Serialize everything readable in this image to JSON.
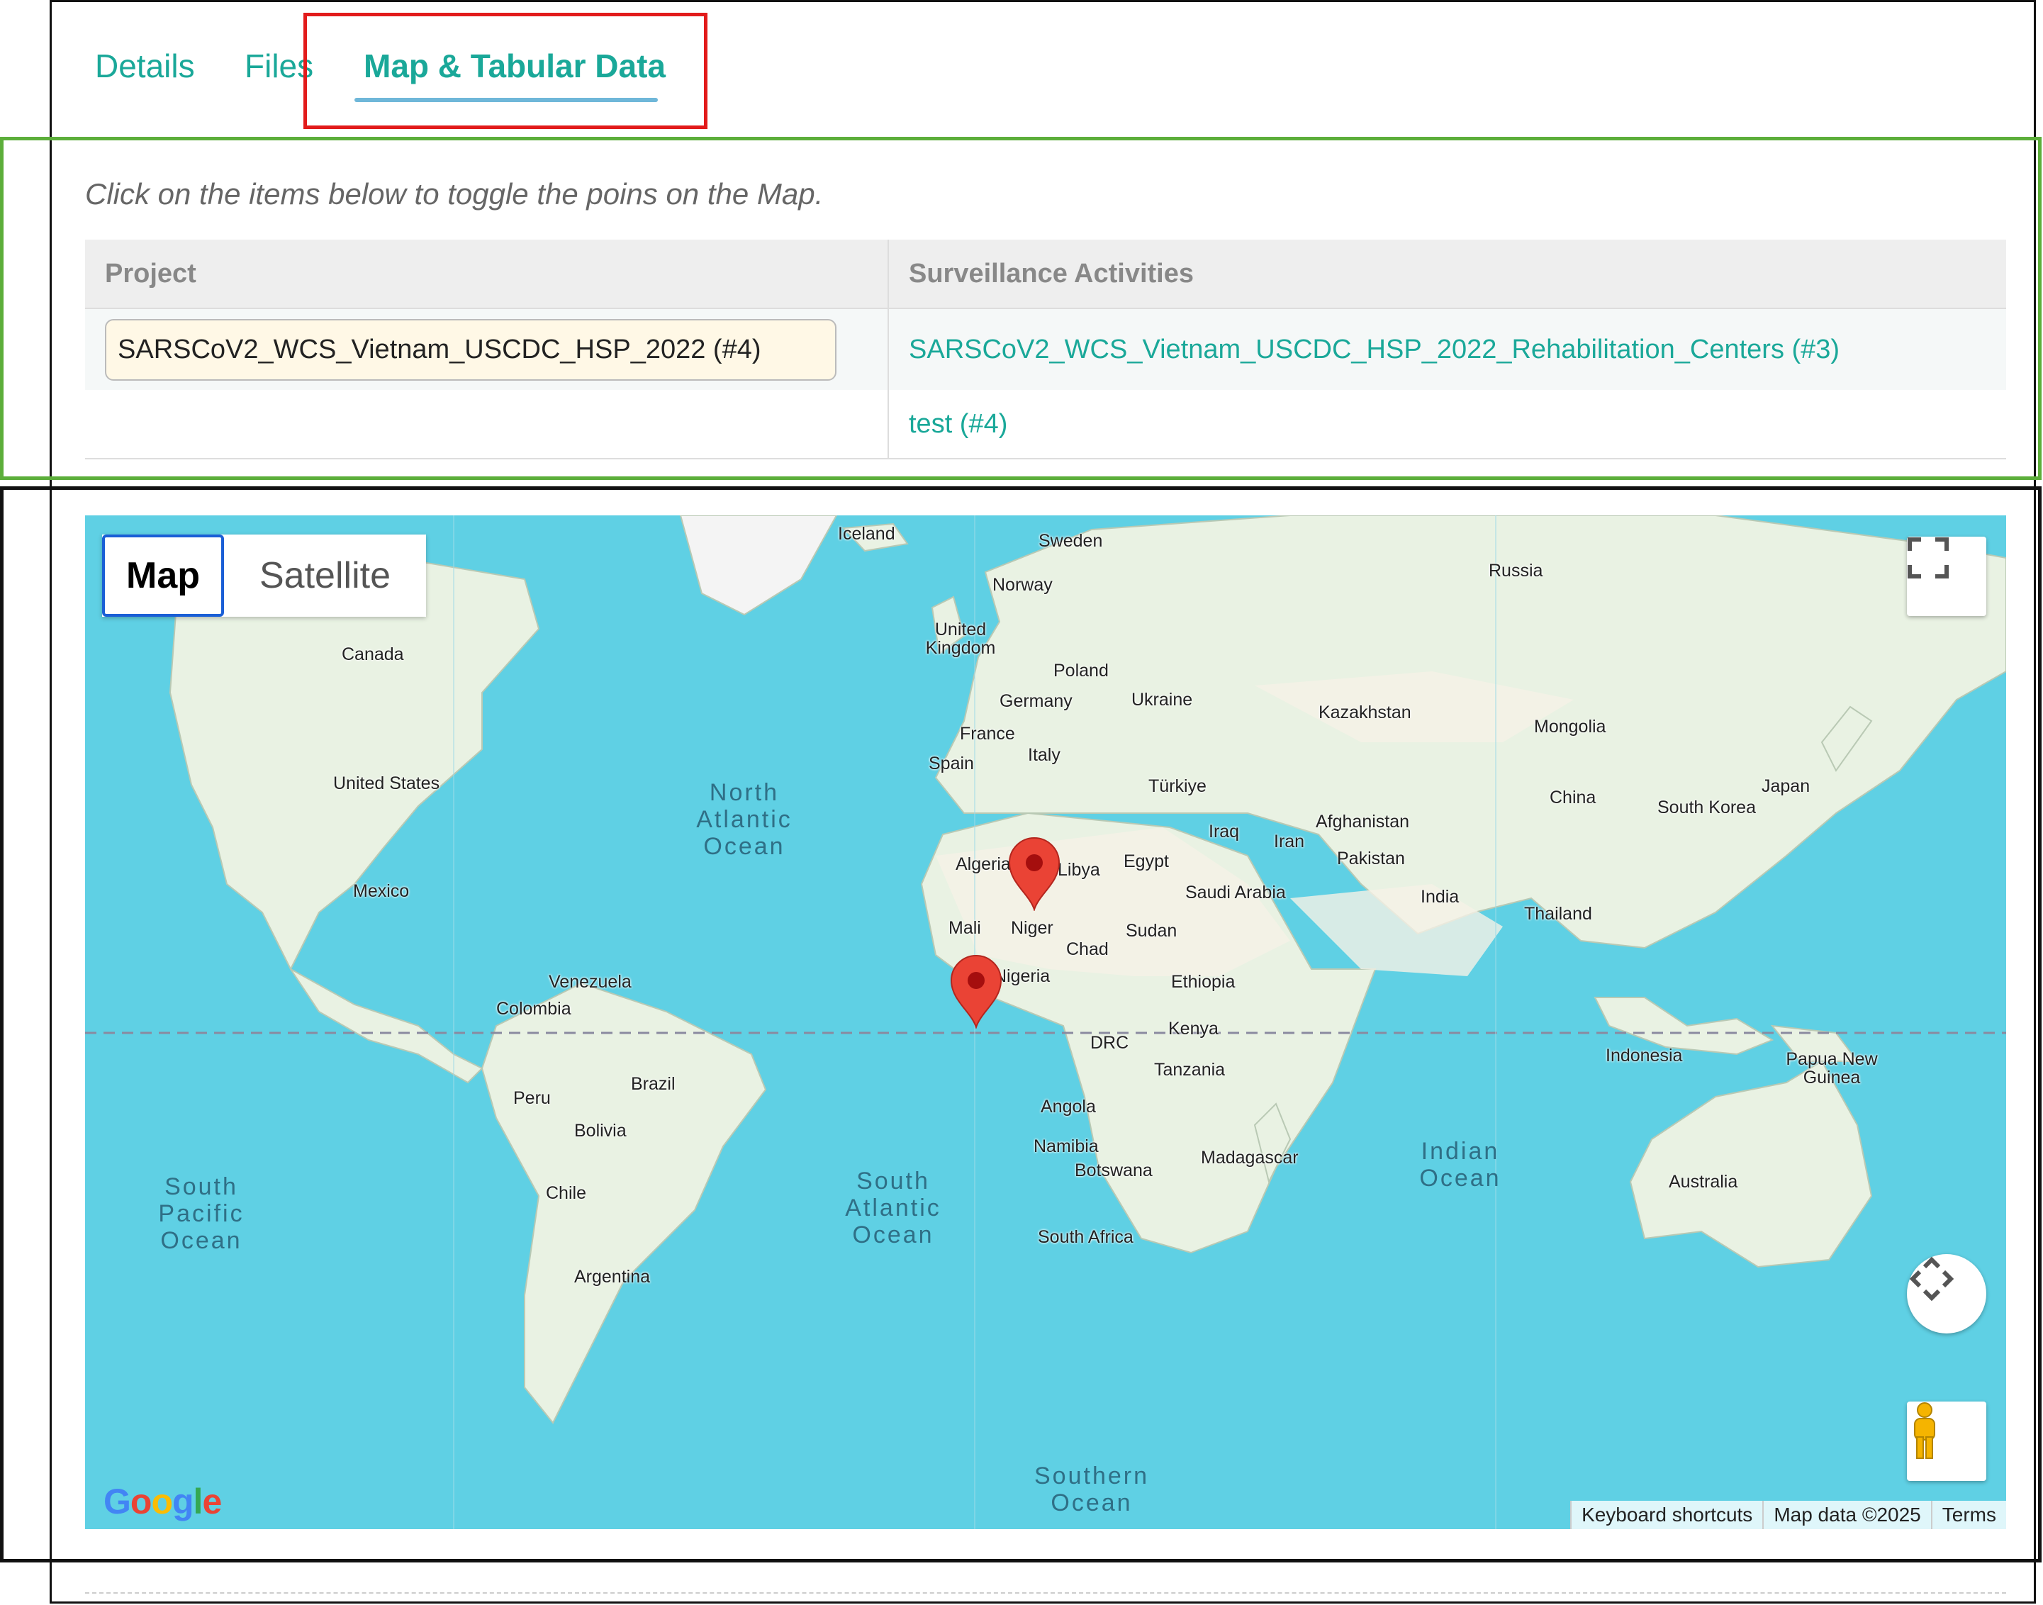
{
  "tabs": [
    {
      "label": "Details"
    },
    {
      "label": "Files"
    },
    {
      "label": "Map & Tabular Data"
    }
  ],
  "hint": "Click on the items below to toggle the poins on the Map.",
  "table": {
    "headers": [
      "Project",
      "Surveillance Activities"
    ],
    "project": "SARSCoV2_WCS_Vietnam_USCDC_HSP_2022 (#4)",
    "activities": [
      "SARSCoV2_WCS_Vietnam_USCDC_HSP_2022_Rehabilitation_Centers (#3)",
      "test (#4)"
    ]
  },
  "map": {
    "type_buttons": {
      "map": "Map",
      "satellite": "Satellite"
    },
    "countries": {
      "iceland": "Iceland",
      "sweden": "Sweden",
      "norway": "Norway",
      "russia": "Russia",
      "uk": "United Kingdom",
      "poland": "Poland",
      "germany": "Germany",
      "ukraine": "Ukraine",
      "france": "France",
      "italy": "Italy",
      "spain": "Spain",
      "kazakhstan": "Kazakhstan",
      "mongolia": "Mongolia",
      "turkiye": "Türkiye",
      "canada": "Canada",
      "us": "United States",
      "mexico": "Mexico",
      "algeria": "Algeria",
      "libya": "Libya",
      "egypt": "Egypt",
      "iraq": "Iraq",
      "iran": "Iran",
      "afghanistan": "Afghanistan",
      "pakistan": "Pakistan",
      "china": "China",
      "south_korea": "South Korea",
      "japan": "Japan",
      "saudi": "Saudi Arabia",
      "india": "India",
      "thailand": "Thailand",
      "mali": "Mali",
      "niger": "Niger",
      "chad": "Chad",
      "sudan": "Sudan",
      "nigeria": "Nigeria",
      "ethiopia": "Ethiopia",
      "venezuela": "Venezuela",
      "colombia": "Colombia",
      "kenya": "Kenya",
      "drc": "DRC",
      "indonesia": "Indonesia",
      "png": "Papua New Guinea",
      "brazil": "Brazil",
      "peru": "Peru",
      "tanzania": "Tanzania",
      "angola": "Angola",
      "bolivia": "Bolivia",
      "namibia": "Namibia",
      "botswana": "Botswana",
      "madagascar": "Madagascar",
      "chile": "Chile",
      "south_africa": "South Africa",
      "australia": "Australia",
      "argentina": "Argentina"
    },
    "oceans": {
      "north_atlantic": "North Atlantic Ocean",
      "south_pacific": "South Pacific Ocean",
      "south_atlantic": "South Atlantic Ocean",
      "indian": "Indian Ocean",
      "southern": "Southern Ocean"
    },
    "attribution": {
      "shortcuts": "Keyboard shortcuts",
      "data": "Map data ©2025",
      "terms": "Terms"
    },
    "logo": "Google"
  }
}
